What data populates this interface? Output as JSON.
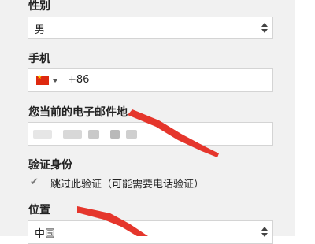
{
  "form": {
    "gender": {
      "label": "性别",
      "value": "男"
    },
    "phone": {
      "label": "手机",
      "flag_icon": "china-flag-icon",
      "value": "+86"
    },
    "email": {
      "label": "您当前的电子邮件地"
    },
    "verify": {
      "label": "验证身份",
      "checkbox_label": "跳过此验证（可能需要电话验证）",
      "checked": true
    },
    "location": {
      "label": "位置",
      "value": "中国"
    }
  },
  "annotation_color": "#e5362c"
}
